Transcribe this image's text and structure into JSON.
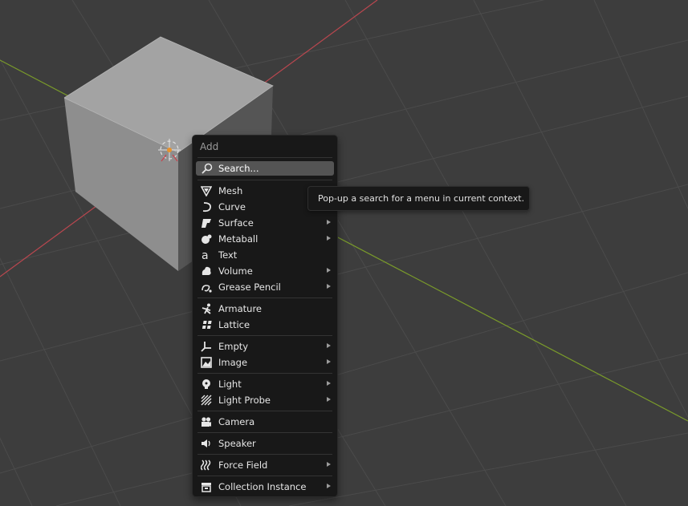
{
  "colors": {
    "viewport_bg": "#3d3d3d",
    "grid_line": "#4a4a4a",
    "axis_x": "#b9474f",
    "axis_y": "#7a9b2a",
    "menu_bg": "#181818",
    "search_bg": "#545454",
    "text": "#e6e6e6",
    "origin_marker": "#e8922c"
  },
  "menu": {
    "title": "Add",
    "search_label": "Search...",
    "groups": [
      [
        {
          "label": "Mesh",
          "icon": "mesh-icon",
          "submenu": true
        },
        {
          "label": "Curve",
          "icon": "curve-icon",
          "submenu": true
        },
        {
          "label": "Surface",
          "icon": "surface-icon",
          "submenu": true
        },
        {
          "label": "Metaball",
          "icon": "metaball-icon",
          "submenu": true
        },
        {
          "label": "Text",
          "icon": "text-icon",
          "submenu": false
        },
        {
          "label": "Volume",
          "icon": "volume-icon",
          "submenu": true
        },
        {
          "label": "Grease Pencil",
          "icon": "grease-pencil-icon",
          "submenu": true
        }
      ],
      [
        {
          "label": "Armature",
          "icon": "armature-icon",
          "submenu": false
        },
        {
          "label": "Lattice",
          "icon": "lattice-icon",
          "submenu": false
        }
      ],
      [
        {
          "label": "Empty",
          "icon": "empty-icon",
          "submenu": true
        },
        {
          "label": "Image",
          "icon": "image-icon",
          "submenu": true
        }
      ],
      [
        {
          "label": "Light",
          "icon": "light-icon",
          "submenu": true
        },
        {
          "label": "Light Probe",
          "icon": "light-probe-icon",
          "submenu": true
        }
      ],
      [
        {
          "label": "Camera",
          "icon": "camera-icon",
          "submenu": false
        }
      ],
      [
        {
          "label": "Speaker",
          "icon": "speaker-icon",
          "submenu": false
        }
      ],
      [
        {
          "label": "Force Field",
          "icon": "force-field-icon",
          "submenu": true
        }
      ],
      [
        {
          "label": "Collection Instance",
          "icon": "collection-instance-icon",
          "submenu": true
        }
      ]
    ]
  },
  "tooltip": {
    "text": "Pop-up a search for a menu in current context."
  }
}
